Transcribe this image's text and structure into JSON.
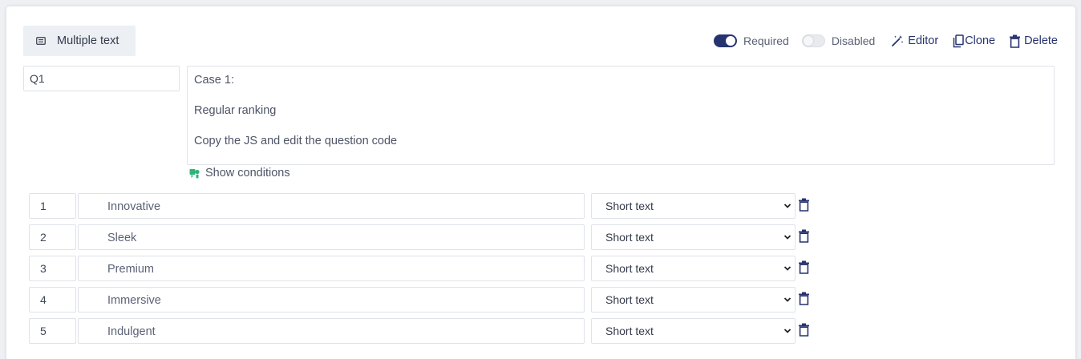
{
  "question": {
    "type_label": "Multiple text",
    "type_icon": "list-icon",
    "id": "Q1",
    "text_lines": [
      "Case 1:",
      "Regular ranking",
      "Copy the JS and edit the question code"
    ],
    "show_conditions_label": "Show conditions",
    "show_conditions_icon": "conditions-icon"
  },
  "toolbar": {
    "required": {
      "label": "Required",
      "on": true
    },
    "disabled": {
      "label": "Disabled",
      "on": false
    },
    "editor_label": "Editor",
    "clone_label": "Clone",
    "delete_label": "Delete"
  },
  "items": [
    {
      "num": "1",
      "label": "Innovative",
      "type": "Short text"
    },
    {
      "num": "2",
      "label": "Sleek",
      "type": "Short text"
    },
    {
      "num": "3",
      "label": "Premium",
      "type": "Short text"
    },
    {
      "num": "4",
      "label": "Immersive",
      "type": "Short text"
    },
    {
      "num": "5",
      "label": "Indulgent",
      "type": "Short text"
    }
  ],
  "colors": {
    "accent": "#27336e",
    "condition_icon": "#2fb37a",
    "border": "#dfe2e8",
    "chip_bg": "#eceff3"
  }
}
